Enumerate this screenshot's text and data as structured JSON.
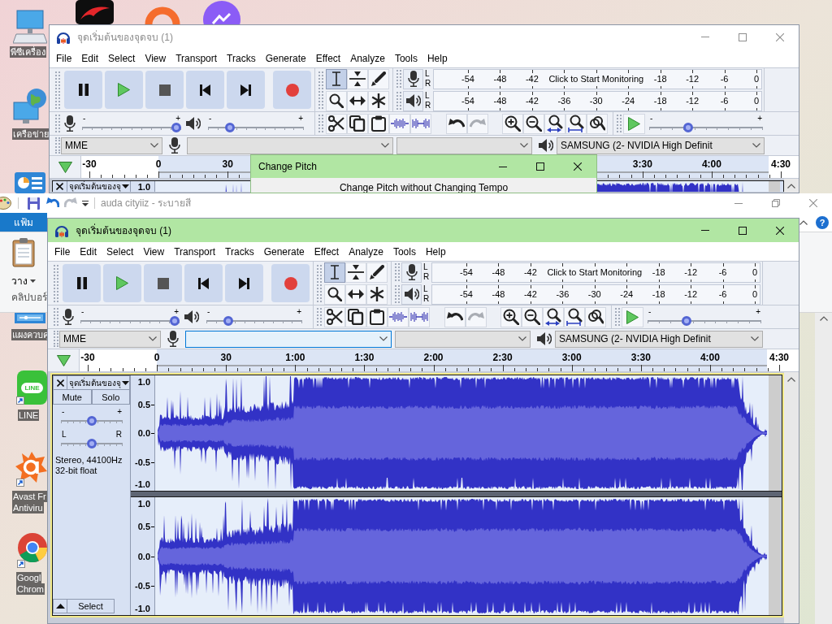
{
  "desktop": {
    "icons": [
      {
        "kind": "computer",
        "label_lines": [
          "พีซีเครื่อง"
        ],
        "shortcut": false
      },
      {
        "kind": "network",
        "label_lines": [
          "เครือข่าย"
        ],
        "shortcut": false
      },
      {
        "kind": "dashboard",
        "shortcut": false
      },
      {
        "kind": "control-panel",
        "label_lines": [
          "แผงควบคุ"
        ],
        "shortcut": false
      },
      {
        "kind": "line",
        "logo_text": "LINE",
        "label_lines": [
          "LINE"
        ],
        "shortcut": true
      },
      {
        "kind": "avast",
        "label_lines": [
          "Avast Fr",
          "Antiviru"
        ],
        "shortcut": true
      },
      {
        "kind": "chrome",
        "label_lines": [
          "Googl",
          "Chrom"
        ],
        "shortcut": true
      }
    ]
  },
  "audacity_back": {
    "active": false,
    "title": "จุดเริ่มต้นของจุดจบ (1)",
    "menu": [
      "File",
      "Edit",
      "Select",
      "View",
      "Transport",
      "Tracks",
      "Generate",
      "Effect",
      "Analyze",
      "Tools",
      "Help"
    ],
    "tools": [
      {
        "kind": "select",
        "selected": true
      },
      {
        "kind": "envelope",
        "selected": false
      },
      {
        "kind": "draw",
        "selected": false
      },
      {
        "kind": "zoom",
        "selected": false
      },
      {
        "kind": "time-shift",
        "selected": false
      },
      {
        "kind": "multi",
        "selected": false
      }
    ],
    "meters": [
      {
        "kind": "record",
        "channels": [
          "L",
          "R"
        ],
        "ticks_before": [
          "-54",
          "-48",
          "-42"
        ],
        "message": "Click to Start Monitoring",
        "ticks_after": [
          "-18",
          "-12",
          "-6",
          "0"
        ]
      },
      {
        "kind": "play",
        "channels": [
          "L",
          "R"
        ],
        "ticks_before": [
          "-54",
          "-48",
          "-42",
          "-36",
          "-30",
          "-24",
          "-18",
          "-12",
          "-6",
          "0"
        ]
      }
    ],
    "mixer": [
      {
        "kind": "record",
        "min_label": "-",
        "max_label": "+",
        "level": 1
      },
      {
        "kind": "play",
        "min_label": "-",
        "max_label": "+",
        "level": 0.2
      }
    ],
    "edit_tools": [
      {
        "kind": "cut",
        "disabled": false
      },
      {
        "kind": "copy",
        "disabled": false
      },
      {
        "kind": "paste",
        "disabled": false
      },
      {
        "kind": "trim",
        "disabled": false
      },
      {
        "kind": "silence",
        "disabled": false
      },
      {
        "kind": "undo",
        "disabled": false
      },
      {
        "kind": "redo",
        "disabled": true
      },
      {
        "kind": "zoom-in",
        "disabled": false
      },
      {
        "kind": "zoom-out",
        "disabled": false
      },
      {
        "kind": "fit-selection",
        "disabled": false
      },
      {
        "kind": "fit-project",
        "disabled": false
      },
      {
        "kind": "zoom-toggle",
        "disabled": false
      }
    ],
    "play_at_speed": {
      "min_label": "-",
      "max_label": "+",
      "level": 0.33
    },
    "devices": [
      {
        "kind": "host",
        "value": "MME",
        "focused": false
      },
      {
        "kind": "recording-device",
        "focused": false
      },
      {
        "kind": "recording-channels",
        "focused": false
      },
      {
        "kind": "playback-device",
        "value": "SAMSUNG (2- NVIDIA High Definit",
        "focused": false
      }
    ],
    "timeline": {
      "ticks_start": [
        "-30",
        "0",
        "30"
      ],
      "ticks_end": [
        "3:30",
        "4:00",
        "4:30"
      ]
    },
    "track": {
      "name": "จุดเริ่มต้นของจุ",
      "channels": [
        {
          "ruler": [
            "1.0"
          ]
        }
      ]
    }
  },
  "change_pitch_dialog": {
    "active": true,
    "title": "Change Pitch",
    "heading": "Change Pitch without Changing Tempo"
  },
  "paint_window": {
    "title": "auda cityiiz - ระบายสี",
    "file_tab": "แฟ้ม",
    "paste_button": "วาง",
    "group_label": "คลิปบอร์",
    "help_button": "?"
  },
  "audacity_front": {
    "active": true,
    "title": "จุดเริ่มต้นของจุดจบ (1)",
    "menu": [
      "File",
      "Edit",
      "Select",
      "View",
      "Transport",
      "Tracks",
      "Generate",
      "Effect",
      "Analyze",
      "Tools",
      "Help"
    ],
    "tools": [
      {
        "kind": "select",
        "selected": true
      },
      {
        "kind": "envelope",
        "selected": false
      },
      {
        "kind": "draw",
        "selected": false
      },
      {
        "kind": "zoom",
        "selected": false
      },
      {
        "kind": "time-shift",
        "selected": false
      },
      {
        "kind": "multi",
        "selected": false
      }
    ],
    "meters": [
      {
        "kind": "record",
        "channels": [
          "L",
          "R"
        ],
        "ticks_before": [
          "-54",
          "-48",
          "-42"
        ],
        "message": "Click to Start Monitoring",
        "ticks_after": [
          "-18",
          "-12",
          "-6",
          "0"
        ]
      },
      {
        "kind": "play",
        "channels": [
          "L",
          "R"
        ],
        "ticks_before": [
          "-54",
          "-48",
          "-42",
          "-36",
          "-30",
          "-24",
          "-18",
          "-12",
          "-6",
          "0"
        ]
      }
    ],
    "mixer": [
      {
        "kind": "record",
        "min_label": "-",
        "max_label": "+",
        "level": 1
      },
      {
        "kind": "play",
        "min_label": "-",
        "max_label": "+",
        "level": 0.2
      }
    ],
    "edit_tools": [
      {
        "kind": "cut",
        "disabled": false
      },
      {
        "kind": "copy",
        "disabled": false
      },
      {
        "kind": "paste",
        "disabled": false
      },
      {
        "kind": "trim",
        "disabled": false
      },
      {
        "kind": "silence",
        "disabled": false
      },
      {
        "kind": "undo",
        "disabled": false
      },
      {
        "kind": "redo",
        "disabled": true
      },
      {
        "kind": "zoom-in",
        "disabled": false
      },
      {
        "kind": "zoom-out",
        "disabled": false
      },
      {
        "kind": "fit-selection",
        "disabled": false
      },
      {
        "kind": "fit-project",
        "disabled": false
      },
      {
        "kind": "zoom-toggle",
        "disabled": false
      }
    ],
    "play_at_speed": {
      "min_label": "-",
      "max_label": "+",
      "level": 0.33
    },
    "devices": [
      {
        "kind": "host",
        "value": "MME",
        "focused": false
      },
      {
        "kind": "recording-device",
        "focused": true
      },
      {
        "kind": "recording-channels",
        "focused": false
      },
      {
        "kind": "playback-device",
        "value": "SAMSUNG (2- NVIDIA High Definit",
        "focused": false
      }
    ],
    "timeline": {
      "ticks_start": [
        "-30",
        "0",
        "30",
        "1:00",
        "1:30",
        "2:00",
        "2:30",
        "3:00",
        "3:30",
        "4:00",
        "4:30"
      ]
    },
    "track": {
      "name": "จุดเริ่มต้นของจุ",
      "buttons": [
        "Mute",
        "Solo"
      ],
      "gain": {
        "min_label": "-",
        "max_label": "+",
        "level": 0.5
      },
      "pan": {
        "min_label": "L",
        "max_label": "R",
        "level": 0.5
      },
      "info": [
        "Stereo, 44100Hz",
        "32-bit float"
      ],
      "select_label": "Select",
      "channels": [
        {
          "ruler": [
            "1.0",
            "0.5",
            "0.0",
            "-0.5",
            "-1.0"
          ]
        },
        {
          "ruler": [
            "1.0",
            "0.5",
            "0.0",
            "-0.5",
            "-1.0"
          ]
        }
      ]
    }
  }
}
